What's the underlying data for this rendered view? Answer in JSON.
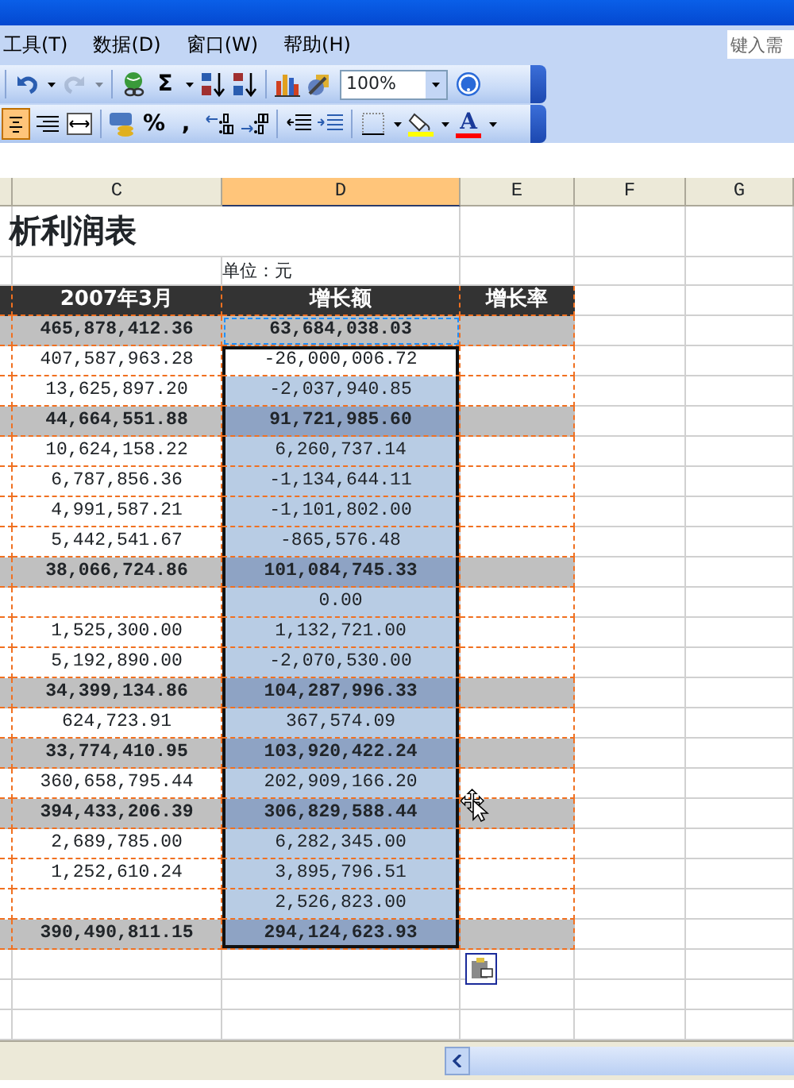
{
  "menu": [
    {
      "label": "工具(T)"
    },
    {
      "label": "数据(D)"
    },
    {
      "label": "窗口(W)"
    },
    {
      "label": "帮助(H)"
    }
  ],
  "help_search": {
    "placeholder": "键入需"
  },
  "toolbar_standard": [
    {
      "kind": "separator"
    },
    {
      "kind": "undo"
    },
    {
      "kind": "caret"
    },
    {
      "kind": "redo",
      "disabled": true
    },
    {
      "kind": "caret",
      "disabled": true
    },
    {
      "kind": "separator"
    },
    {
      "kind": "hyperlink"
    },
    {
      "kind": "glyph",
      "text": "Σ"
    },
    {
      "kind": "caret"
    },
    {
      "kind": "sort-asc"
    },
    {
      "kind": "sort-desc"
    },
    {
      "kind": "separator"
    },
    {
      "kind": "chart"
    },
    {
      "kind": "drawing"
    },
    {
      "kind": "combo",
      "value": "100%"
    },
    {
      "kind": "help"
    }
  ],
  "toolbar_formatting": [
    {
      "kind": "align-center",
      "pressed": true
    },
    {
      "kind": "align-right"
    },
    {
      "kind": "merge"
    },
    {
      "kind": "separator"
    },
    {
      "kind": "currency"
    },
    {
      "kind": "glyph",
      "text": "%"
    },
    {
      "kind": "glyph",
      "text": ","
    },
    {
      "kind": "inc-decimal"
    },
    {
      "kind": "dec-decimal"
    },
    {
      "kind": "separator"
    },
    {
      "kind": "outdent"
    },
    {
      "kind": "indent"
    },
    {
      "kind": "separator"
    },
    {
      "kind": "borders"
    },
    {
      "kind": "caret"
    },
    {
      "kind": "fill",
      "color": "#ffff00"
    },
    {
      "kind": "caret"
    },
    {
      "kind": "font-color",
      "text": "A",
      "color": "#ff0000"
    },
    {
      "kind": "caret"
    }
  ],
  "columns": [
    {
      "label": "C",
      "selected": false
    },
    {
      "label": "D",
      "selected": true
    },
    {
      "label": "E",
      "selected": false
    },
    {
      "label": "F",
      "selected": false
    },
    {
      "label": "G",
      "selected": false
    }
  ],
  "sheet_title": "析利润表",
  "unit_label": "单位：元",
  "table_headers": [
    "2007年3月",
    "增长额",
    "增长率"
  ],
  "rows": [
    {
      "kind": "subtotal",
      "c": "465,878,412.36",
      "d": "63,684,038.03",
      "selected": false,
      "active": false
    },
    {
      "kind": "detail",
      "c": "407,587,963.28",
      "d": "-26,000,006.72",
      "selected": true,
      "active": true
    },
    {
      "kind": "detail",
      "c": "13,625,897.20",
      "d": "-2,037,940.85",
      "selected": true,
      "active": false
    },
    {
      "kind": "subtotal",
      "c": "44,664,551.88",
      "d": "91,721,985.60",
      "selected": true,
      "active": false
    },
    {
      "kind": "detail",
      "c": "10,624,158.22",
      "d": "6,260,737.14",
      "selected": true,
      "active": false
    },
    {
      "kind": "detail",
      "c": "6,787,856.36",
      "d": "-1,134,644.11",
      "selected": true,
      "active": false
    },
    {
      "kind": "detail",
      "c": "4,991,587.21",
      "d": "-1,101,802.00",
      "selected": true,
      "active": false
    },
    {
      "kind": "detail",
      "c": "5,442,541.67",
      "d": "-865,576.48",
      "selected": true,
      "active": false
    },
    {
      "kind": "subtotal",
      "c": "38,066,724.86",
      "d": "101,084,745.33",
      "selected": true,
      "active": false
    },
    {
      "kind": "detail",
      "d": "0.00",
      "selected": true,
      "active": false
    },
    {
      "kind": "detail",
      "c": "1,525,300.00",
      "d": "1,132,721.00",
      "selected": true,
      "active": false
    },
    {
      "kind": "detail",
      "c": "5,192,890.00",
      "d": "-2,070,530.00",
      "selected": true,
      "active": false
    },
    {
      "kind": "subtotal",
      "c": "34,399,134.86",
      "d": "104,287,996.33",
      "selected": true,
      "active": false
    },
    {
      "kind": "detail",
      "c": "624,723.91",
      "d": "367,574.09",
      "selected": true,
      "active": false
    },
    {
      "kind": "subtotal",
      "c": "33,774,410.95",
      "d": "103,920,422.24",
      "selected": true,
      "active": false
    },
    {
      "kind": "detail",
      "c": "360,658,795.44",
      "d": "202,909,166.20",
      "selected": true,
      "active": false
    },
    {
      "kind": "subtotal",
      "c": "394,433,206.39",
      "d": "306,829,588.44",
      "selected": true,
      "active": false
    },
    {
      "kind": "detail",
      "c": "2,689,785.00",
      "d": "6,282,345.00",
      "selected": true,
      "active": false
    },
    {
      "kind": "detail",
      "c": "1,252,610.24",
      "d": "3,895,796.51",
      "selected": true,
      "active": false
    },
    {
      "kind": "detail",
      "d": "2,526,823.00",
      "selected": true,
      "active": false
    },
    {
      "kind": "subtotal",
      "c": "390,490,811.15",
      "d": "294,124,623.93",
      "selected": true,
      "active": false
    }
  ]
}
